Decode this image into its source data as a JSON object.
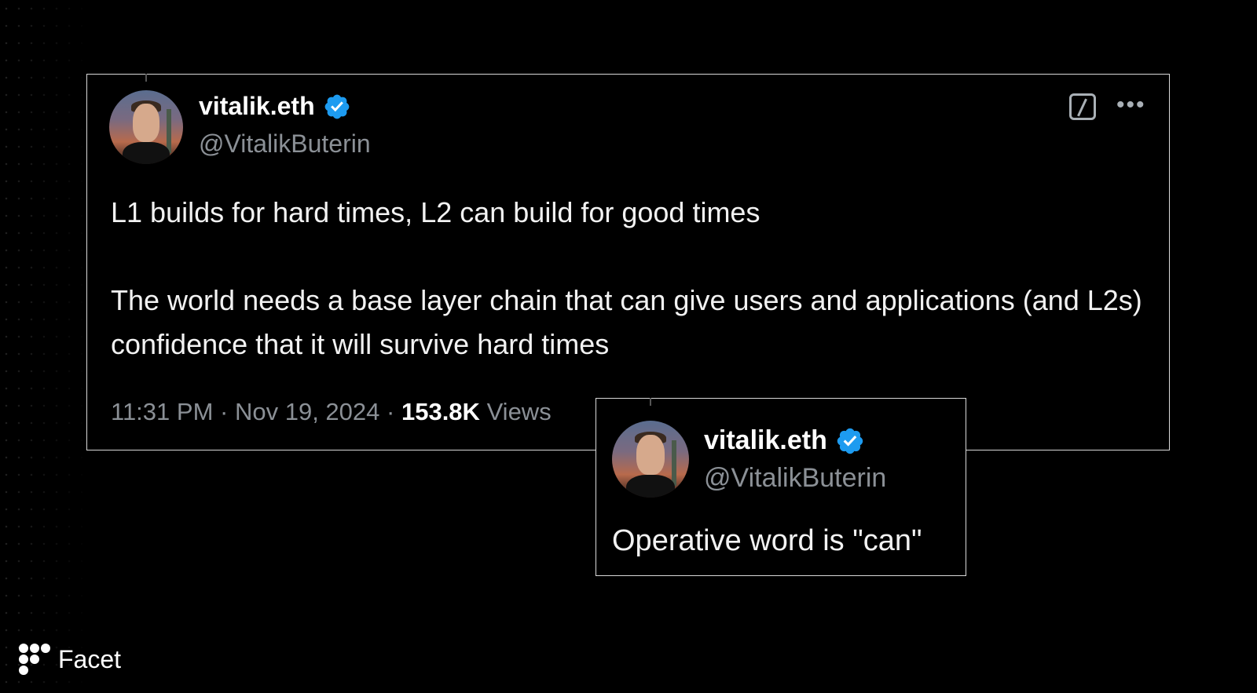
{
  "colors": {
    "background": "#000000",
    "border": "#d9d9d9",
    "verified_badge": "#1d9bf0",
    "muted_text": "#8b9096",
    "text": "#f2f2f2"
  },
  "main_tweet": {
    "author_name": "vitalik.eth",
    "handle": "@VitalikButerin",
    "verified_icon": "verified-badge-icon",
    "paragraphs": [
      "L1 builds for hard times, L2 can build for good times",
      "The world needs a base layer chain that can give users and applications (and L2s) confidence that it will survive hard times"
    ],
    "time": "11:31 PM",
    "separator": "·",
    "date": "Nov 19, 2024",
    "views_count": "153.8K",
    "views_label": "Views",
    "grok_icon": "grok-icon",
    "more_icon": "more-horizontal-icon"
  },
  "reply_tweet": {
    "author_name": "vitalik.eth",
    "handle": "@VitalikButerin",
    "text": "Operative word is \"can\""
  },
  "brand": {
    "name": "Facet",
    "logo_icon": "facet-logo-icon"
  }
}
